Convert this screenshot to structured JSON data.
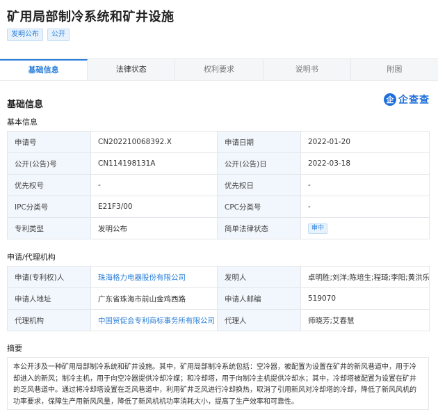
{
  "title": "矿用局部制冷系统和矿井设施",
  "tags": [
    "发明公布",
    "公开"
  ],
  "tabs": [
    "基础信息",
    "法律状态",
    "权利要求",
    "说明书",
    "附图"
  ],
  "section_title": "基础信息",
  "logo_mark": "企",
  "logo_text": "企查查",
  "basic": {
    "title": "基本信息",
    "rows": [
      [
        "申请号",
        "CN202210068392.X",
        "申请日期",
        "2022-01-20"
      ],
      [
        "公开(公告)号",
        "CN114198131A",
        "公开(公告)日",
        "2022-03-18"
      ],
      [
        "优先权号",
        "-",
        "优先权日",
        "-"
      ],
      [
        "IPC分类号",
        "E21F3/00",
        "CPC分类号",
        "-"
      ],
      [
        "专利类型",
        "发明公布",
        "简单法律状态",
        "审中"
      ]
    ]
  },
  "agency": {
    "title": "申请/代理机构",
    "rows": [
      [
        "申请(专利权)人",
        "珠海格力电器股份有限公司",
        "发明人",
        "卓明胜;刘洋;陈培生;程琦;李阳;黄洪乐"
      ],
      [
        "申请人地址",
        "广东省珠海市前山金鸡西路",
        "申请人邮编",
        "519070"
      ],
      [
        "代理机构",
        "中国贸促会专利商标事务所有限公司",
        "代理人",
        "师晓芳;艾春慧"
      ]
    ]
  },
  "abstract": {
    "title": "摘要",
    "text": "本公开涉及一种矿用局部制冷系统和矿井设施。其中，矿用局部制冷系统包括：空冷器，被配置为设置在矿井的新风巷道中，用于冷却进入的新风；制冷主机，用于向空冷器提供冷却冷媒；和冷却塔，用于向制冷主机提供冷却水；其中，冷却塔被配置为设置在矿井的乏风巷道中。通过将冷却塔设置在乏风巷道中，利用矿井乏风进行冷却换热，取消了引用新风对冷却塔的冷却，降低了新风风机的功率要求，保障生产用新风风量，降低了新风机机功率消耗大小，提高了生产效率和可靠性。"
  },
  "colors": {
    "accent": "#2b7fd8",
    "key_bg": "#f2f7fd",
    "logo": "#1e6fd9"
  }
}
